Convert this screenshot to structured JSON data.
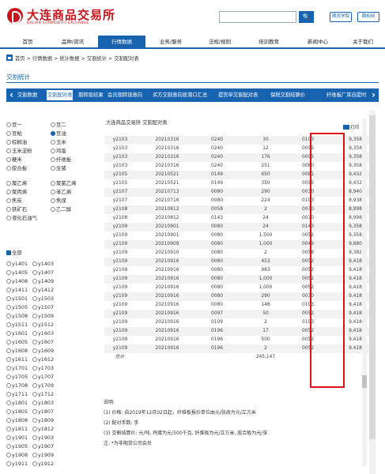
{
  "header": {
    "logo_cn": "大连商品交易所",
    "logo_en": "DALIAN COMMODITY EXCHANGE",
    "search_placeholder": "",
    "search_icon": "search-icon",
    "btn1": "期货学院",
    "btn2": "期权网"
  },
  "nav": [
    "首页",
    "品种/资讯",
    "行情数据",
    "业务/服务",
    "法规/规则",
    "培训教育",
    "新闻中心",
    "关于我们"
  ],
  "breadcrumb": "首页 > 行情数据 > 统计数据 > 交割统计 > 交割配对表",
  "section_title": "交割统计",
  "tabs": [
    "交割数据",
    "交割配对表",
    "期转现结果",
    "会员期转现意向",
    "买方交割意向按港口汇总",
    "提货单交割配对表",
    "保税交割结算价",
    "纤维板厂库自提时"
  ],
  "varieties": [
    [
      "豆一",
      "豆二"
    ],
    [
      "豆粕",
      "豆油"
    ],
    [
      "棕榈油",
      "玉米"
    ],
    [
      "玉米淀粉",
      "鸡蛋"
    ],
    [
      "粳米",
      "纤维板"
    ],
    [
      "胶合板",
      "生猪"
    ],
    [
      "聚乙烯",
      "聚氯乙烯"
    ],
    [
      "聚丙烯",
      "苯乙烯"
    ],
    [
      "焦炭",
      "焦煤"
    ],
    [
      "铁矿石",
      "乙二醇"
    ],
    [
      "液化石油气",
      ""
    ]
  ],
  "selected_variety": "豆油",
  "all_label": "全部",
  "contracts": [
    [
      "y1401",
      "y1403"
    ],
    [
      "y1405",
      "y1407"
    ],
    [
      "y1408",
      "y1409"
    ],
    [
      "y1411",
      "y1412"
    ],
    [
      "y1501",
      "y1503"
    ],
    [
      "y1505",
      "y1507"
    ],
    [
      "y1508",
      "y1509"
    ],
    [
      "y1511",
      "y1512"
    ],
    [
      "y1601",
      "y1603"
    ],
    [
      "y1605",
      "y1607"
    ],
    [
      "y1608",
      "y1609"
    ],
    [
      "y1611",
      "y1612"
    ],
    [
      "y1701",
      "y1703"
    ],
    [
      "y1705",
      "y1707"
    ],
    [
      "y1708",
      "y1709"
    ],
    [
      "y1711",
      "y1712"
    ],
    [
      "y1801",
      "y1803"
    ],
    [
      "y1805",
      "y1807"
    ],
    [
      "y1808",
      "y1809"
    ],
    [
      "y1811",
      "y1812"
    ],
    [
      "y1901",
      "y1903"
    ],
    [
      "y1905",
      "y1907"
    ],
    [
      "y1908",
      "y1909"
    ],
    [
      "y1911",
      "y1912"
    ]
  ],
  "date_title": "大连商品交易所 交割配对表",
  "print_label": "打印",
  "rows": [
    [
      "y2103",
      "20210316",
      "0240",
      "30",
      "0103",
      "9,358"
    ],
    [
      "y2103",
      "20210316",
      "0240",
      "12",
      "0095",
      "9,358"
    ],
    [
      "y2103",
      "20210316",
      "0240",
      "176",
      "0095",
      "9,358"
    ],
    [
      "y2103",
      "20210316",
      "0240",
      "251",
      "0080",
      "9,358"
    ],
    [
      "y2105",
      "20210521",
      "0149",
      "650",
      "0081",
      "9,432"
    ],
    [
      "y2105",
      "20210521",
      "0149",
      "350",
      "0095",
      "9,432"
    ],
    [
      "y2107",
      "20210713",
      "0080",
      "290",
      "0030",
      "8,940"
    ],
    [
      "y2107",
      "20210716",
      "0080",
      "224",
      "0103",
      "8,938"
    ],
    [
      "y2108",
      "20210812",
      "0058",
      "2",
      "0030",
      "8,998"
    ],
    [
      "y2108",
      "20210812",
      "0143",
      "24",
      "0030",
      "8,998"
    ],
    [
      "y2109",
      "20210901",
      "0080",
      "24",
      "0143",
      "9,358"
    ],
    [
      "y2109",
      "20210901",
      "0080",
      "1,500",
      "0052",
      "9,358"
    ],
    [
      "y2109",
      "20210909",
      "0080",
      "1,000",
      "0049",
      "9,680"
    ],
    [
      "y2109",
      "20210910",
      "0080",
      "2",
      "0058",
      "9,382"
    ],
    [
      "y2109",
      "20210916",
      "0080",
      "453",
      "0052",
      "9,418"
    ],
    [
      "y2109",
      "20210916",
      "0080",
      "983",
      "0052",
      "9,418"
    ],
    [
      "y2109",
      "20210916",
      "0080",
      "1,000",
      "0052",
      "9,418"
    ],
    [
      "y2109",
      "20210916",
      "0080",
      "1,000",
      "0052",
      "9,418"
    ],
    [
      "y2109",
      "20210916",
      "0080",
      "290",
      "0030",
      "9,418"
    ],
    [
      "y2109",
      "20210916",
      "0080",
      "148",
      "0103",
      "9,418"
    ],
    [
      "y2109",
      "20210916",
      "0097",
      "50",
      "0052",
      "9,418"
    ],
    [
      "y2109",
      "20210916",
      "0109",
      "2",
      "0103",
      "9,418"
    ],
    [
      "y2109",
      "20210916",
      "0196",
      "17",
      "0052",
      "9,418"
    ],
    [
      "y2109",
      "20210916",
      "0196",
      "500",
      "0052",
      "9,418"
    ],
    [
      "y2109",
      "20210916",
      "0196",
      "2",
      "0052",
      "9,418"
    ]
  ],
  "total_label": "总计",
  "total_value": "245,147",
  "notes_title": "说明:",
  "notes": [
    "(1) 价格: 自2019年12月02日起，纤维板报价单位由元/张改为元/立方米",
    "(2) 配对手数: 手",
    "(3) 交割结算价: 元/吨, 鸡蛋为元/500千克, 纤维板为元/立方米, 胶合板为元/张",
    "注: *为非期货公司会员"
  ]
}
